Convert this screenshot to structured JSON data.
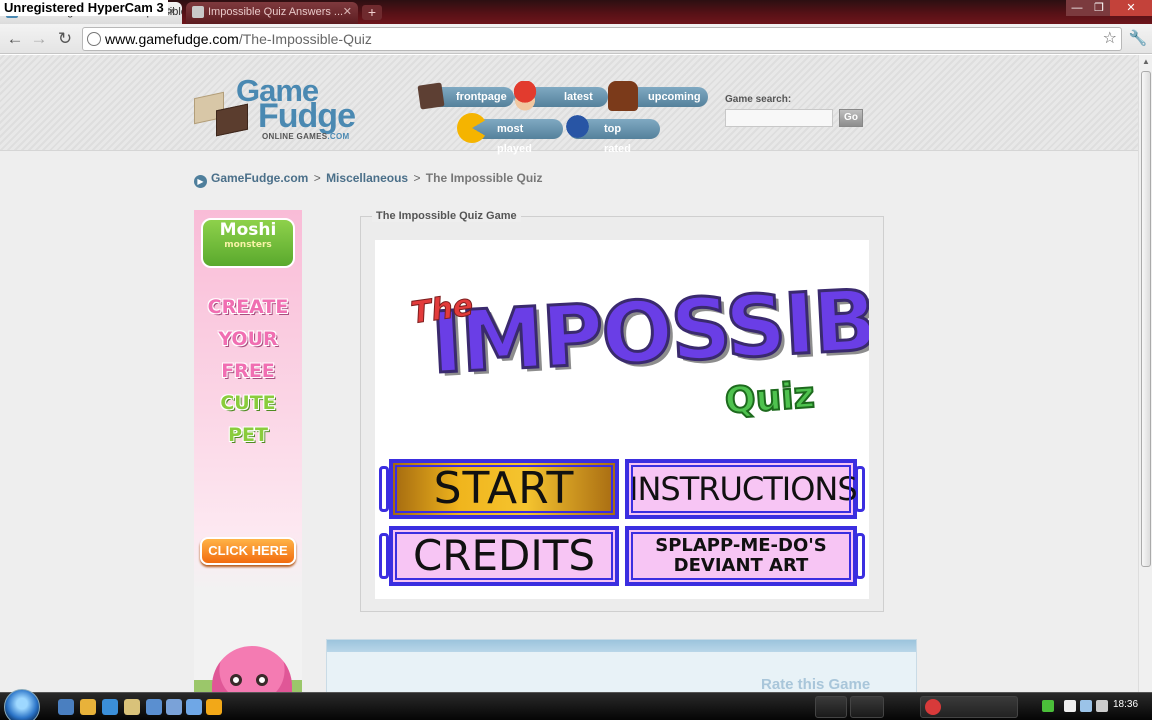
{
  "browser": {
    "recorder_overlay": "Unregistered HyperCam 3",
    "tabs": [
      {
        "label": "Gamefudge.com / The Impossible Quiz"
      },
      {
        "label": "Impossible Quiz Answers ..."
      }
    ],
    "new_tab_label": "+",
    "window_controls": {
      "minimize": "—",
      "maximize": "❐",
      "close": "✕"
    },
    "url_host": "www.gamefudge.com",
    "url_path": "/The-Impossible-Quiz"
  },
  "site": {
    "logo": {
      "line1": "Game",
      "line2": "Fudge",
      "tagline": "ONLINE GAMES",
      "domain": ".COM"
    },
    "nav": {
      "frontpage": "frontpage",
      "latest": "latest",
      "upcoming": "upcoming",
      "most_played": "most played",
      "top_rated": "top rated"
    },
    "search": {
      "label": "Game search:",
      "value": "",
      "go": "Go"
    },
    "breadcrumb": {
      "home": "GameFudge.com",
      "sep": ">",
      "category": "Miscellaneous",
      "current": "The Impossible Quiz"
    }
  },
  "ad": {
    "brand": "Moshi",
    "brand_sub": "monsters",
    "words": [
      "CREATE",
      "YOUR",
      "FREE",
      "CUTE",
      "PET"
    ],
    "cta": "CLICK HERE"
  },
  "game": {
    "panel_title": "The Impossible Quiz Game",
    "title_the": "The",
    "title_main": "IMPOSSIBLE",
    "title_quiz": "Quiz",
    "buttons": {
      "start": "START",
      "instructions": "INSTRUCTIONS",
      "credits": "CREDITS",
      "splapp_line1": "SPLAPP-ME-DO'S",
      "splapp_line2": "DEVIANT ART"
    }
  },
  "rate": {
    "title": "Rate this Game"
  },
  "taskbar": {
    "clock": "18:36"
  }
}
